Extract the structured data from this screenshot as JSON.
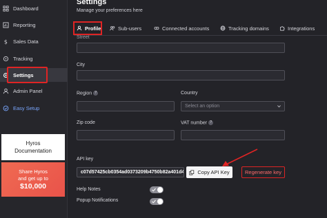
{
  "sidebar": {
    "items": [
      {
        "label": "Dashboard",
        "icon": "grid-icon"
      },
      {
        "label": "Reporting",
        "icon": "chart-icon"
      },
      {
        "label": "Sales Data",
        "icon": "dollar-icon"
      },
      {
        "label": "Tracking",
        "icon": "target-icon"
      },
      {
        "label": "Settings",
        "icon": "gear-icon"
      },
      {
        "label": "Admin Panel",
        "icon": "user-icon"
      },
      {
        "label": "Easy Setup",
        "icon": "check-circle-icon"
      }
    ],
    "docs_card": {
      "line1": "Hyros",
      "line2": "Documentation"
    },
    "promo_card": {
      "line1": "Share Hyros",
      "line2": "and get up to",
      "amount": "$10,000"
    }
  },
  "header": {
    "title": "Settings",
    "subtitle": "Manage your preferences here"
  },
  "tabs": [
    {
      "label": "Profile",
      "icon": "user-icon"
    },
    {
      "label": "Sub-users",
      "icon": "users-icon"
    },
    {
      "label": "Connected accounts",
      "icon": "link-icon"
    },
    {
      "label": "Tracking domains",
      "icon": "globe-icon"
    },
    {
      "label": "Integrations",
      "icon": "puzzle-icon"
    }
  ],
  "form": {
    "street_label": "Street",
    "city_label": "City",
    "region_label": "Region",
    "country_label": "Country",
    "country_placeholder": "Select an option",
    "zip_label": "Zip code",
    "vat_label": "VAT number",
    "help_glyph": "?",
    "api_key_label": "API key",
    "api_key_value": "c07d57425cb0354ad0373209b4750b82a401d4",
    "copy_label": "Copy API Key",
    "regenerate_label": "Regenerate key",
    "help_notes_label": "Help Notes",
    "popup_label": "Popup Notifications"
  },
  "colors": {
    "accent_red": "#e02424",
    "background": "#232328"
  }
}
